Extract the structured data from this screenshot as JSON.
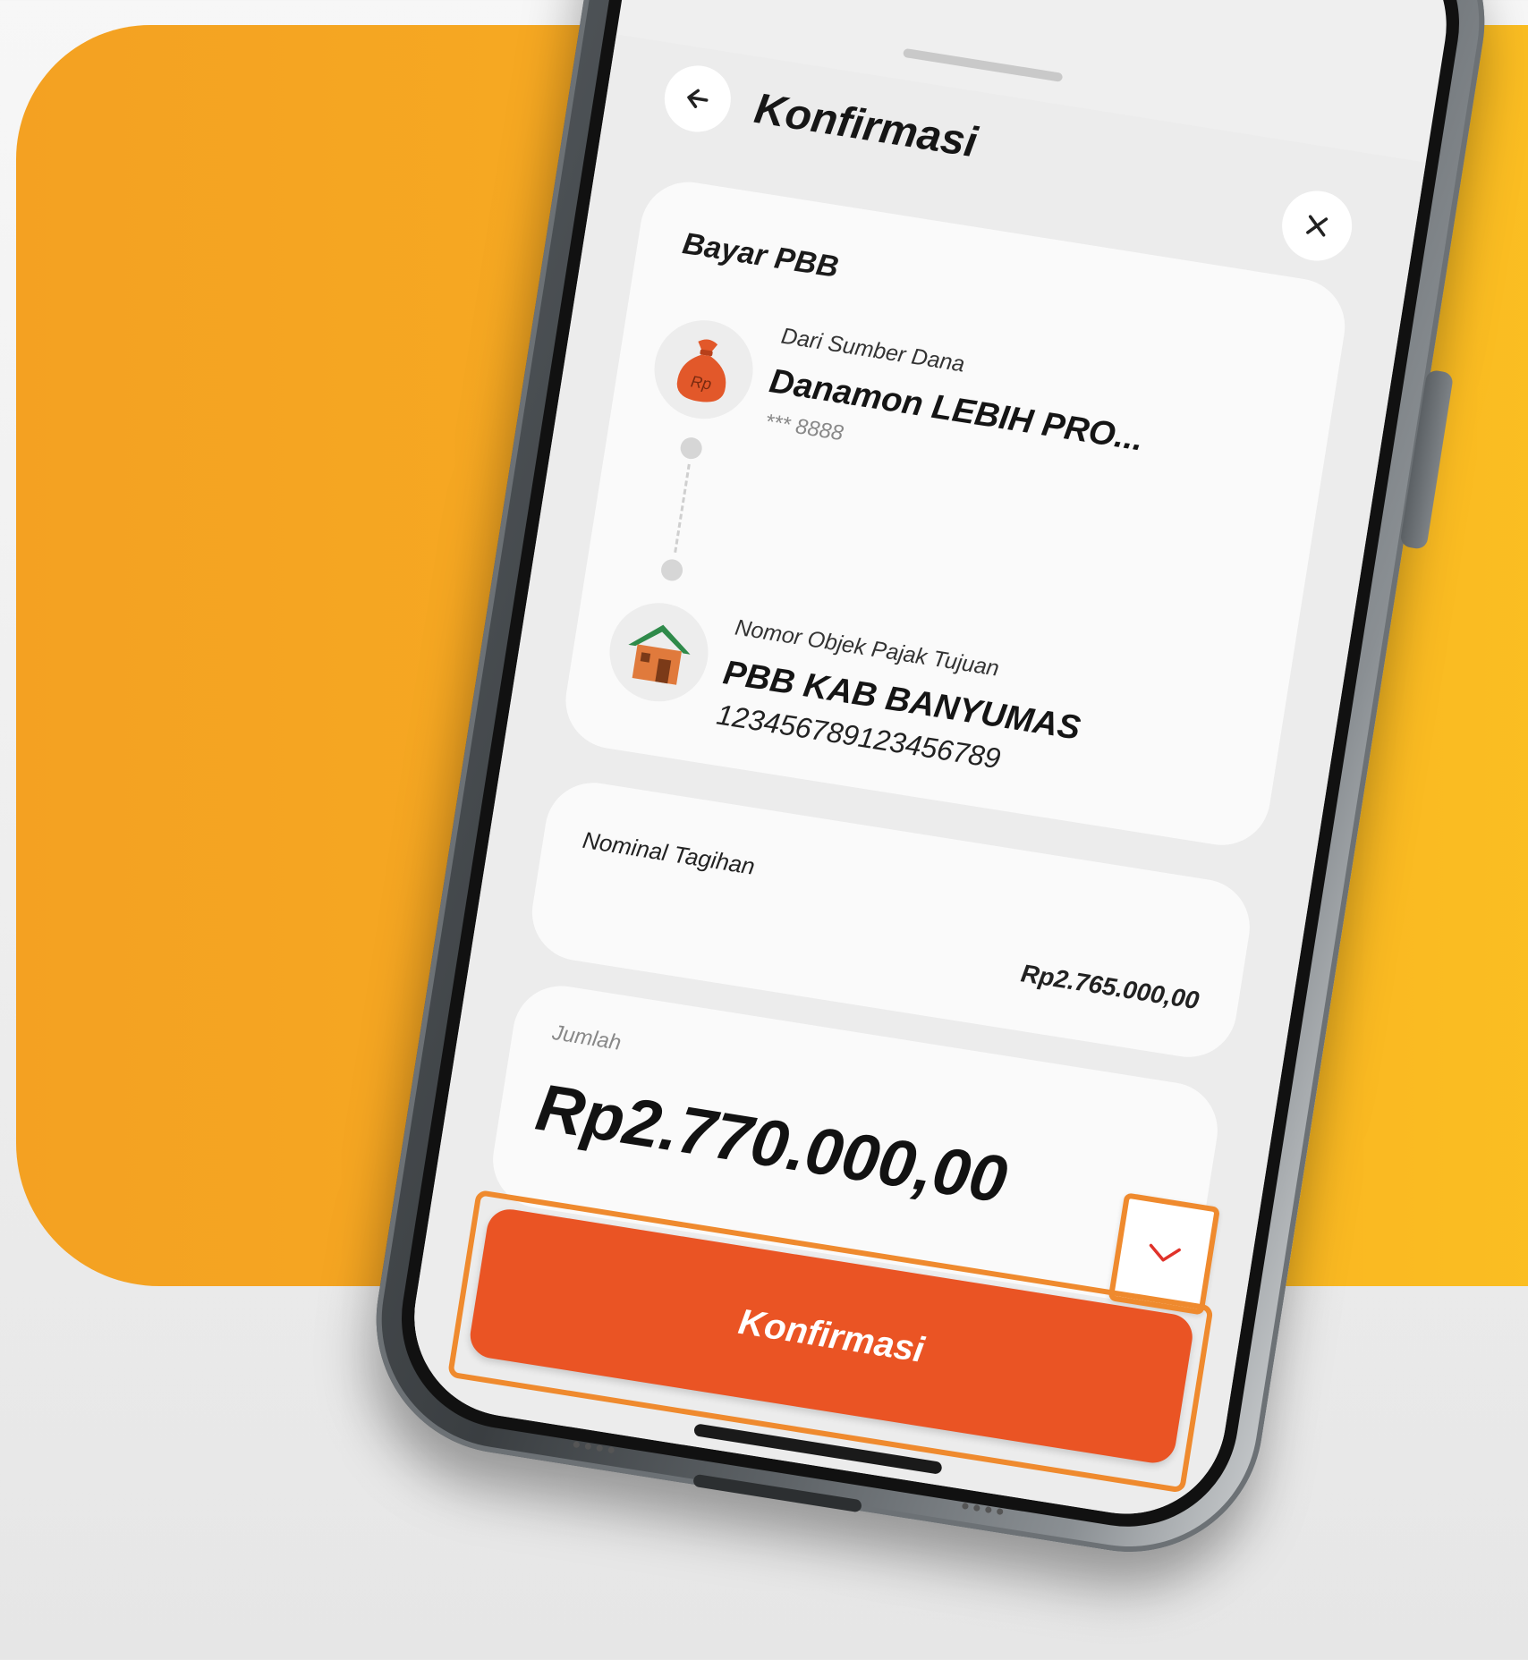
{
  "colors": {
    "background_orange": "#f5a623",
    "primary": "#ea5424",
    "highlight": "#ef8a2e"
  },
  "header": {
    "title": "Konfirmasi",
    "back_icon": "arrow-left-icon",
    "close_icon": "close-icon"
  },
  "summary": {
    "title": "Bayar PBB",
    "source": {
      "icon": "money-bag-icon",
      "label": "Dari Sumber Dana",
      "name": "Danamon LEBIH PRO...",
      "account": "*** 8888"
    },
    "destination": {
      "icon": "house-icon",
      "label": "Nomor Objek Pajak Tujuan",
      "name": "PBB KAB BANYUMAS",
      "number": "123456789123456789"
    }
  },
  "nominal": {
    "label": "Nominal Tagihan",
    "value": "Rp2.765.000,00"
  },
  "amount": {
    "label": "Jumlah",
    "value": "Rp2.770.000,00",
    "expand_icon": "chevron-down-icon"
  },
  "confirm_button": {
    "label": "Konfirmasi"
  },
  "bag_label": "Rp"
}
